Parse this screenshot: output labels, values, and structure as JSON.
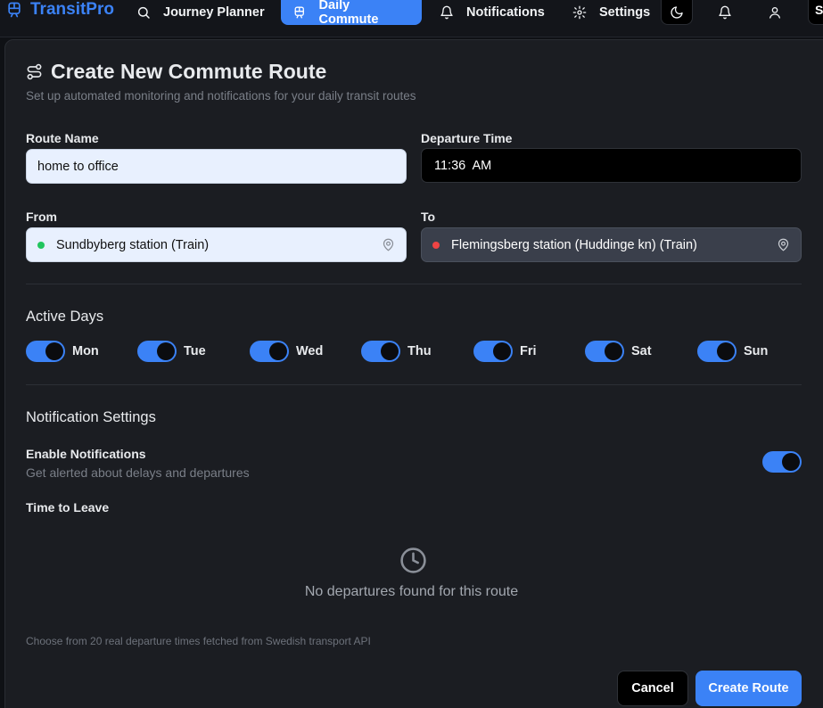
{
  "app": {
    "brand": "TransitPro",
    "brand_color": "#3b82f6"
  },
  "nav": {
    "journey_planner": "Journey Planner",
    "daily_commute": "Daily Commute",
    "notifications": "Notifications",
    "settings": "Settings",
    "avatar_initial": "S"
  },
  "form": {
    "title": "Create New Commute Route",
    "subtitle": "Set up automated monitoring and notifications for your daily transit routes",
    "route_name_label": "Route Name",
    "route_name_value": "home to office",
    "departure_time_label": "Departure Time",
    "departure_time_value": "11:36  AM",
    "from_label": "From",
    "from_value": "Sundbyberg station (Train)",
    "to_label": "To",
    "to_value": "Flemingsberg station (Huddinge kn) (Train)",
    "from_dot_color": "#22c55e",
    "to_dot_color": "#ef4444"
  },
  "active_days": {
    "title": "Active Days",
    "days": [
      {
        "label": "Mon",
        "on": true
      },
      {
        "label": "Tue",
        "on": true
      },
      {
        "label": "Wed",
        "on": true
      },
      {
        "label": "Thu",
        "on": true
      },
      {
        "label": "Fri",
        "on": true
      },
      {
        "label": "Sat",
        "on": true
      },
      {
        "label": "Sun",
        "on": true
      }
    ]
  },
  "notifications": {
    "title": "Notification Settings",
    "enable_label": "Enable Notifications",
    "enable_desc": "Get alerted about delays and departures",
    "enabled": true,
    "time_to_leave_label": "Time to Leave",
    "empty_text": "No departures found for this route",
    "hint": "Choose from 20 real departure times fetched from Swedish transport API"
  },
  "actions": {
    "cancel": "Cancel",
    "create": "Create Route"
  }
}
